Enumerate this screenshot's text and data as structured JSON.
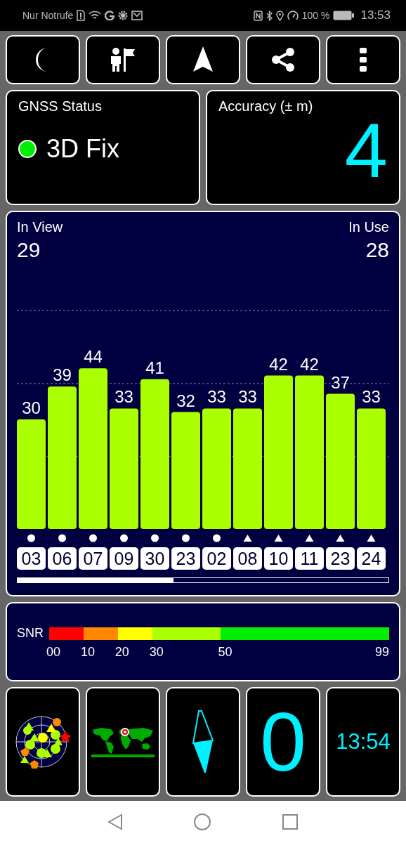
{
  "status_bar": {
    "carrier": "Nur Notrufe",
    "battery": "100 %",
    "time": "13:53"
  },
  "gnss_status": {
    "title": "GNSS Status",
    "fix": "3D Fix",
    "color": "#00ee00"
  },
  "accuracy": {
    "title": "Accuracy (± m)",
    "value": "4"
  },
  "satellites": {
    "in_view_label": "In View",
    "in_view": "29",
    "in_use_label": "In Use",
    "in_use": "28",
    "markers": [
      {
        "kind": "circle"
      },
      {
        "kind": "circle"
      },
      {
        "kind": "circle"
      },
      {
        "kind": "circle"
      },
      {
        "kind": "circle"
      },
      {
        "kind": "circle"
      },
      {
        "kind": "circle"
      },
      {
        "kind": "triangle"
      },
      {
        "kind": "triangle"
      },
      {
        "kind": "triangle"
      },
      {
        "kind": "triangle"
      },
      {
        "kind": "triangle"
      }
    ],
    "chart_data": {
      "type": "bar",
      "categories": [
        "03",
        "06",
        "07",
        "09",
        "30",
        "23",
        "02",
        "08",
        "10",
        "11",
        "23",
        "24"
      ],
      "series": [
        {
          "color": "#aaff00",
          "values": [
            30,
            39,
            44,
            33,
            41,
            32,
            33,
            33,
            42,
            42,
            37,
            33
          ]
        }
      ],
      "data_labels": true
    }
  },
  "snr_legend": {
    "label": "SNR",
    "segments": [
      {
        "label": "00",
        "color": "#ff0000"
      },
      {
        "label": "10",
        "color": "#ff8800"
      },
      {
        "label": "20",
        "color": "#ffff00"
      },
      {
        "label": "30",
        "color": "#aaff00"
      },
      {
        "label": "50",
        "color": "#00ee00"
      }
    ],
    "end_label": "99"
  },
  "tiles": [
    {
      "kind": "number",
      "text": "0"
    },
    {
      "kind": "clock",
      "text": "13:54"
    }
  ]
}
